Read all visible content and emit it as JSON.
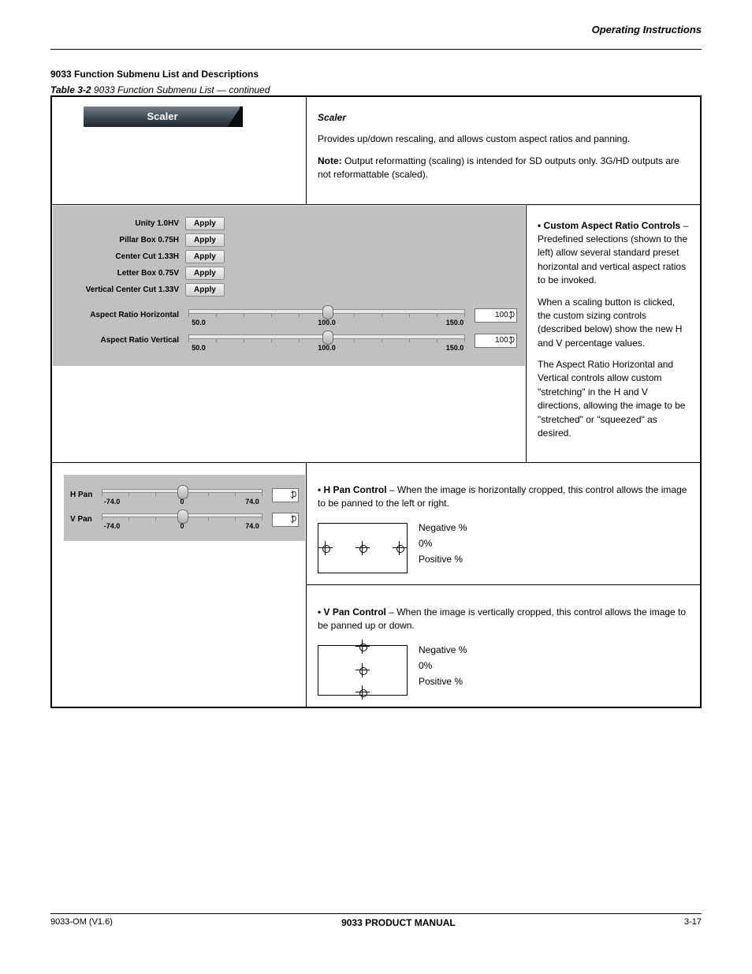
{
  "header": {
    "right": "Operating Instructions"
  },
  "section_title": "9033 Function Submenu List and Descriptions",
  "intro_label": "Table 3-2",
  "intro_rest": "9033 Function Submenu List — continued",
  "row_labels": {
    "chip": "Scaler",
    "lead": "Scaler",
    "custom_arc": "• Custom Aspect Ratio Controls"
  },
  "row_desc": {
    "p1": "Provides up/down rescaling, and allows custom aspect ratios and panning.",
    "note_bold": "Note:",
    "note_body": "Output reformatting (scaling) is intended for SD outputs only. 3G/HD outputs are not reformattable (scaled).",
    "p3b": " – Predefined selections (shown to the left) allow several standard preset horizontal and vertical aspect ratios to be invoked.",
    "p4": "When a scaling button is clicked, the custom sizing controls (described below) show the new H and V percentage values.",
    "p5": "The Aspect Ratio Horizontal and Vertical controls allow custom \"stretching\" in the H and V directions, allowing the image to be \"stretched\" or \"squeezed\" as desired."
  },
  "aspect_panel": {
    "presets": [
      {
        "label": "Unity 1.0HV",
        "btn": "Apply"
      },
      {
        "label": "Pillar Box 0.75H",
        "btn": "Apply"
      },
      {
        "label": "Center Cut 1.33H",
        "btn": "Apply"
      },
      {
        "label": "Letter Box 0.75V",
        "btn": "Apply"
      },
      {
        "label": "Vertical Center Cut 1.33V",
        "btn": "Apply"
      }
    ],
    "sliders": [
      {
        "label": "Aspect Ratio Horizontal",
        "min": "50.0",
        "mid": "100.0",
        "max": "150.0",
        "value": "100.0"
      },
      {
        "label": "Aspect Ratio Vertical",
        "min": "50.0",
        "mid": "100.0",
        "max": "150.0",
        "value": "100.0"
      }
    ]
  },
  "pan_panel": {
    "sliders": [
      {
        "label": "H Pan",
        "min": "-74.0",
        "mid": "0",
        "max": "74.0",
        "value": "0"
      },
      {
        "label": "V Pan",
        "min": "-74.0",
        "mid": "0",
        "max": "74.0",
        "value": "0"
      }
    ]
  },
  "hpan": {
    "lead": "• H Pan Control",
    "body": " – When the image is horizontally cropped, this control allows the image to be panned to the left or right.",
    "neg": "Negative %",
    "zero": "0%",
    "pos": "Positive %"
  },
  "vpan": {
    "lead": "• V Pan Control",
    "body": " – When the image is vertically cropped, this control allows the image to be panned up or down.",
    "neg": "Negative %",
    "zero": "0%",
    "pos": "Positive %"
  },
  "footer": {
    "left": "9033-OM (V1.6)",
    "mid": "9033 PRODUCT MANUAL",
    "right": "3-17"
  }
}
